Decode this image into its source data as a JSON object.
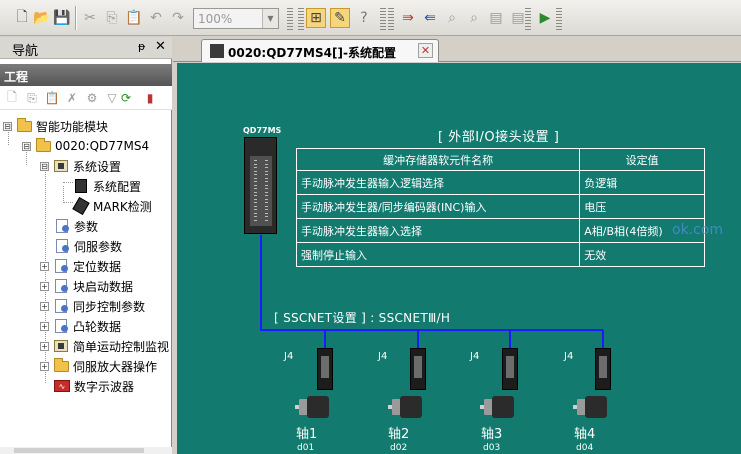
{
  "toolbar": {
    "zoom_value": "100%"
  },
  "nav": {
    "title": "导航",
    "pin": "ᵽ",
    "close": "✕",
    "project_title": "工程"
  },
  "tree": [
    {
      "label": "智能功能模块",
      "toggle": "⊟"
    },
    {
      "label": "0020:QD77MS4",
      "toggle": "⊟"
    },
    {
      "label": "系统设置",
      "toggle": "⊟"
    },
    {
      "label": "系统配置",
      "toggle": ""
    },
    {
      "label": "MARK检测",
      "toggle": ""
    },
    {
      "label": "参数",
      "toggle": ""
    },
    {
      "label": "伺服参数",
      "toggle": ""
    },
    {
      "label": "定位数据",
      "toggle": "+"
    },
    {
      "label": "块启动数据",
      "toggle": "+"
    },
    {
      "label": "同步控制参数",
      "toggle": "+"
    },
    {
      "label": "凸轮数据",
      "toggle": "+"
    },
    {
      "label": "简单运动控制监视",
      "toggle": "+"
    },
    {
      "label": "伺服放大器操作",
      "toggle": "+"
    },
    {
      "label": "数字示波器",
      "toggle": ""
    }
  ],
  "tab": {
    "label": "0020:QD77MS4[]-系统配置",
    "close": "✕"
  },
  "canvas": {
    "module_label": "QD77MS",
    "io_title": "[ 外部I/O接头设置 ]",
    "io_headers": [
      "缓冲存储器软元件名称",
      "设定值"
    ],
    "io_rows": [
      {
        "name": "手动脉冲发生器输入逻辑选择",
        "value": "负逻辑"
      },
      {
        "name": "手动脉冲发生器/同步编码器(INC)输入",
        "value": "电压"
      },
      {
        "name": "手动脉冲发生器输入选择",
        "value": "A相/B相(4倍频)"
      },
      {
        "name": "强制停止输入",
        "value": "无效"
      }
    ],
    "sscnet_title": "[ SSCNET设置 ] : SSCNETⅢ/H",
    "axes": [
      {
        "connector": "J4",
        "name": "轴1",
        "code": "d01"
      },
      {
        "connector": "J4",
        "name": "轴2",
        "code": "d02"
      },
      {
        "connector": "J4",
        "name": "轴3",
        "code": "d03"
      },
      {
        "connector": "J4",
        "name": "轴4",
        "code": "d04"
      }
    ],
    "watermark": "ok.com"
  },
  "colors": {
    "canvas_bg": "#127a6f",
    "line_blue": "#1a1aff"
  }
}
